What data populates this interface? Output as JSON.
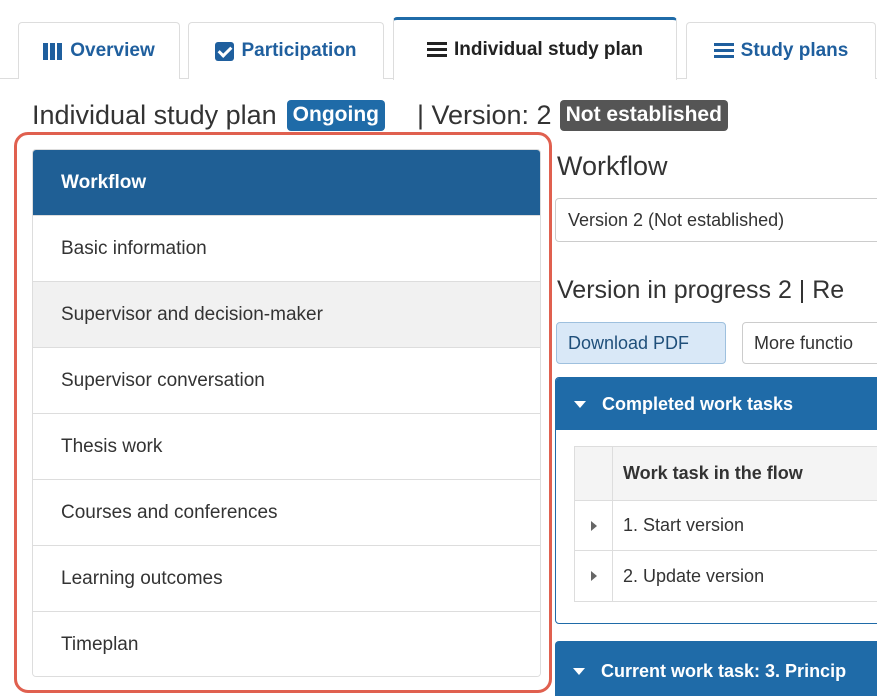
{
  "tabs": [
    {
      "label": "Overview",
      "icon": "map-icon"
    },
    {
      "label": "Participation",
      "icon": "check-square-icon"
    },
    {
      "label": "Individual study plan",
      "icon": "list-icon"
    },
    {
      "label": "Study plans",
      "icon": "list-icon"
    }
  ],
  "active_tab": "Individual study plan",
  "header": {
    "title": "Individual study plan",
    "status_badge": "Ongoing",
    "version_label": "| Version: 2",
    "version_badge": "Not established"
  },
  "sidebar": {
    "active": "Workflow",
    "items": [
      {
        "label": "Workflow"
      },
      {
        "label": "Basic information"
      },
      {
        "label": "Supervisor and decision-maker"
      },
      {
        "label": "Supervisor conversation"
      },
      {
        "label": "Thesis work"
      },
      {
        "label": "Courses and conferences"
      },
      {
        "label": "Learning outcomes"
      },
      {
        "label": "Timeplan"
      }
    ]
  },
  "main": {
    "section_title": "Workflow",
    "version_select_value": "Version 2 (Not established)",
    "version_in_progress": "Version in progress 2 | Re",
    "buttons": {
      "download_pdf": "Download PDF",
      "more_functions": "More functio"
    },
    "completed_panel": {
      "title": "Completed work tasks",
      "column_header": "Work task in the flow",
      "rows": [
        "1. Start version",
        "2. Update version"
      ]
    },
    "current_panel_title": "Current work task: 3. Princip"
  },
  "colors": {
    "primary": "#1f6ba8",
    "sidebar_active": "#1f5f95",
    "badge_dark": "#555555",
    "highlight_outline": "#e0604f"
  }
}
